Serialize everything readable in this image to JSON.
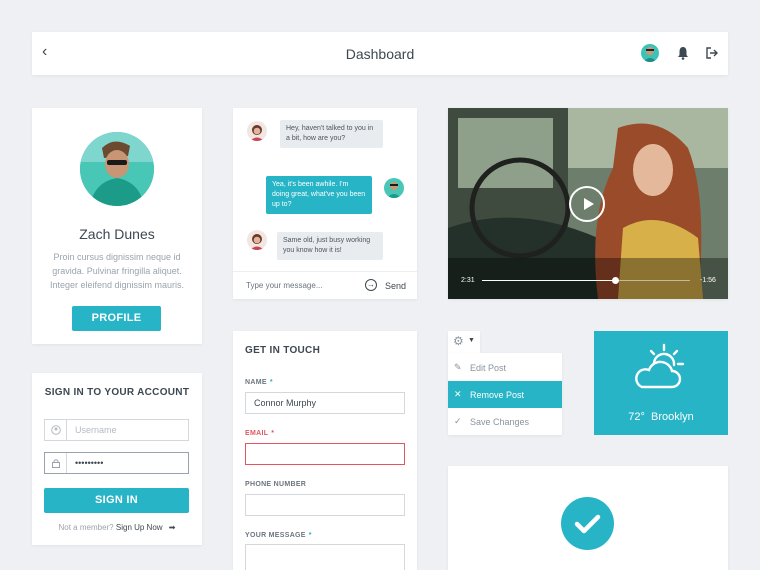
{
  "topbar": {
    "title": "Dashboard"
  },
  "profile": {
    "name": "Zach Dunes",
    "bio": "Proin cursus dignissim neque id gravida. Pulvinar fringilla aliquet. Integer eleifend dignissim mauris.",
    "button": "PROFILE"
  },
  "signin": {
    "title": "SIGN IN TO YOUR ACCOUNT",
    "username_placeholder": "Username",
    "password_value": "•••••••••",
    "button": "SIGN IN",
    "footer_text": "Not a member?",
    "footer_link": "Sign Up Now"
  },
  "chat": {
    "messages": [
      {
        "from": "her",
        "text": "Hey, haven't talked to you in a bit, how are you?"
      },
      {
        "from": "me",
        "text": "Yea, it's been awhile. I'm doing great, what've you been up to?"
      },
      {
        "from": "her",
        "text": "Same old, just busy working you know how it is!"
      }
    ],
    "input_placeholder": "Type your message...",
    "send": "Send"
  },
  "contact": {
    "title": "GET IN TOUCH",
    "name_label": "NAME",
    "name_value": "Connor Murphy",
    "email_label": "EMAIL",
    "phone_label": "PHONE NUMBER",
    "message_label": "YOUR MESSAGE",
    "required_mark": "*"
  },
  "video": {
    "elapsed": "2:31",
    "remaining": "-1:56",
    "progress": 0.64
  },
  "dropdown": {
    "items": [
      {
        "label": "Edit Post",
        "icon": "pencil-icon"
      },
      {
        "label": "Remove Post",
        "icon": "close-icon"
      },
      {
        "label": "Save Changes",
        "icon": "check-icon"
      }
    ],
    "selected_index": 1
  },
  "weather": {
    "temp": "72°",
    "city": "Brooklyn",
    "icon": "partly-cloudy-icon"
  },
  "colors": {
    "accent": "#26b4c6",
    "error": "#e25563",
    "background": "#eef0f3"
  }
}
